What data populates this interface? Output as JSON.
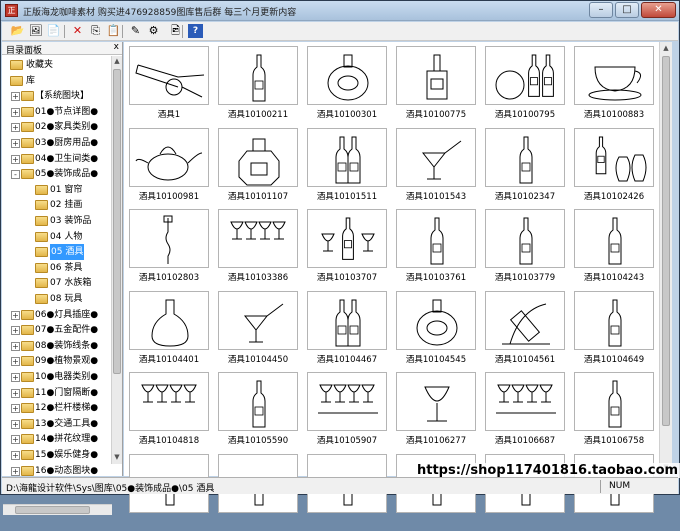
{
  "window": {
    "title": "正版海龙咖啡素材 购买进476928859图库售后群 每三个月更新内容",
    "minimize_label": "–",
    "maximize_label": "□",
    "close_label": "✕"
  },
  "toolbar": {
    "buttons": [
      {
        "name": "open-icon",
        "glyph": "📂"
      },
      {
        "name": "image-view-icon",
        "glyph": "🖼"
      },
      {
        "name": "list-view-icon",
        "glyph": "📄"
      },
      {
        "name": "delete-icon",
        "glyph": "✕"
      },
      {
        "name": "copy-icon",
        "glyph": "⎘"
      },
      {
        "name": "paste-icon",
        "glyph": "📋"
      },
      {
        "name": "edit-icon",
        "glyph": "✎"
      },
      {
        "name": "tools-icon",
        "glyph": "⚙"
      },
      {
        "name": "image-icon",
        "glyph": "🖻"
      },
      {
        "name": "help-icon",
        "glyph": "?"
      }
    ]
  },
  "sidebar": {
    "title": "目录面板",
    "close_label": "x",
    "nodes": [
      {
        "label": "收藏夹",
        "level": 0,
        "expander": ""
      },
      {
        "label": "库",
        "level": 0,
        "expander": ""
      },
      {
        "label": "【系统图块】",
        "level": 1,
        "expander": "+"
      },
      {
        "label": "01●节点详图●",
        "level": 1,
        "expander": "+"
      },
      {
        "label": "02●家具类别●",
        "level": 1,
        "expander": "+"
      },
      {
        "label": "03●厨房用品●",
        "level": 1,
        "expander": "+"
      },
      {
        "label": "04●卫生间类●",
        "level": 1,
        "expander": "+"
      },
      {
        "label": "05●装饰成品●",
        "level": 1,
        "expander": "-"
      },
      {
        "label": "01 窗帘",
        "level": 2,
        "expander": ""
      },
      {
        "label": "02 挂画",
        "level": 2,
        "expander": ""
      },
      {
        "label": "03 装饰品",
        "level": 2,
        "expander": ""
      },
      {
        "label": "04 人物",
        "level": 2,
        "expander": ""
      },
      {
        "label": "05 酒具",
        "level": 2,
        "expander": "",
        "selected": true
      },
      {
        "label": "06 茶具",
        "level": 2,
        "expander": ""
      },
      {
        "label": "07 水族箱",
        "level": 2,
        "expander": ""
      },
      {
        "label": "08 玩具",
        "level": 2,
        "expander": ""
      },
      {
        "label": "06●灯具插座●",
        "level": 1,
        "expander": "+"
      },
      {
        "label": "07●五金配件●",
        "level": 1,
        "expander": "+"
      },
      {
        "label": "08●装饰线条●",
        "level": 1,
        "expander": "+"
      },
      {
        "label": "09●植物景观●",
        "level": 1,
        "expander": "+"
      },
      {
        "label": "10●电器类别●",
        "level": 1,
        "expander": "+"
      },
      {
        "label": "11●门窗隔断●",
        "level": 1,
        "expander": "+"
      },
      {
        "label": "12●栏杆楼梯●",
        "level": 1,
        "expander": "+"
      },
      {
        "label": "13●交通工具●",
        "level": 1,
        "expander": "+"
      },
      {
        "label": "14●拼花纹理●",
        "level": 1,
        "expander": "+"
      },
      {
        "label": "15●娱乐健身●",
        "level": 1,
        "expander": "+"
      },
      {
        "label": "16●动态图块●",
        "level": 1,
        "expander": "+"
      }
    ]
  },
  "gallery": {
    "items": [
      {
        "label": "酒具1",
        "icon": "bottle-cart-icon"
      },
      {
        "label": "酒具10100211",
        "icon": "bottle-icon"
      },
      {
        "label": "酒具10100301",
        "icon": "bottle-round-icon"
      },
      {
        "label": "酒具10100775",
        "icon": "bottle-square-icon"
      },
      {
        "label": "酒具10100795",
        "icon": "bottles-group-icon"
      },
      {
        "label": "酒具10100883",
        "icon": "teacup-icon"
      },
      {
        "label": "酒具10100981",
        "icon": "teapot-icon"
      },
      {
        "label": "酒具10101107",
        "icon": "octagon-bottle-icon"
      },
      {
        "label": "酒具10101511",
        "icon": "bottle-pair-icon"
      },
      {
        "label": "酒具10101543",
        "icon": "cocktail-glass-icon"
      },
      {
        "label": "酒具10102347",
        "icon": "bottle-icon"
      },
      {
        "label": "酒具10102426",
        "icon": "vase-set-icon"
      },
      {
        "label": "酒具10102803",
        "icon": "corkscrew-icon"
      },
      {
        "label": "酒具10103386",
        "icon": "wine-glasses-icon"
      },
      {
        "label": "酒具10103707",
        "icon": "bottle-glasses-icon"
      },
      {
        "label": "酒具10103761",
        "icon": "bottle-icon"
      },
      {
        "label": "酒具10103779",
        "icon": "bottle-icon"
      },
      {
        "label": "酒具10104243",
        "icon": "bottle-icon"
      },
      {
        "label": "酒具10104401",
        "icon": "decanter-icon"
      },
      {
        "label": "酒具10104450",
        "icon": "cocktail-glass-icon"
      },
      {
        "label": "酒具10104467",
        "icon": "bottle-pair-icon"
      },
      {
        "label": "酒具10104545",
        "icon": "bottle-round-icon"
      },
      {
        "label": "酒具10104561",
        "icon": "bottle-holder-icon"
      },
      {
        "label": "酒具10104649",
        "icon": "bottle-icon"
      },
      {
        "label": "酒具10104818",
        "icon": "wine-glasses-icon"
      },
      {
        "label": "酒具10105590",
        "icon": "bottle-icon"
      },
      {
        "label": "酒具10105907",
        "icon": "goblet-set-icon"
      },
      {
        "label": "酒具10106277",
        "icon": "wine-glass-icon"
      },
      {
        "label": "酒具10106687",
        "icon": "goblet-set-icon"
      },
      {
        "label": "酒具10106758",
        "icon": "bottle-icon"
      },
      {
        "label": "",
        "icon": "blank-icon"
      },
      {
        "label": "",
        "icon": "blank-icon"
      },
      {
        "label": "",
        "icon": "blank-icon"
      },
      {
        "label": "",
        "icon": "blank-icon"
      },
      {
        "label": "",
        "icon": "blank-icon"
      },
      {
        "label": "",
        "icon": "blank-icon"
      }
    ]
  },
  "watermark": "https://shop117401816.taobao.com",
  "status": {
    "path": "D:\\海龍设计软件\\Sys\\图库\\05●装饰成品●\\05 酒具",
    "num": "NUM"
  }
}
